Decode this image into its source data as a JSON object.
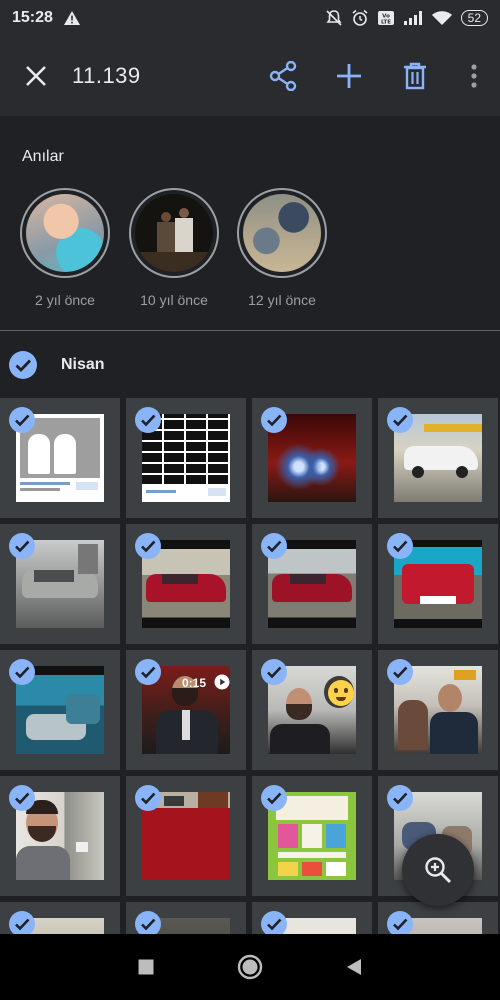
{
  "status": {
    "time": "15:28",
    "battery": "52",
    "icons": [
      "warning-icon",
      "mute-icon",
      "alarm-icon",
      "volte-icon",
      "signal-icon",
      "wifi-icon",
      "battery-icon"
    ]
  },
  "toolbar": {
    "count": "11.139",
    "icons": [
      "close-icon",
      "share-icon",
      "add-icon",
      "delete-icon",
      "more-vert-icon"
    ]
  },
  "memories": {
    "title": "Anılar",
    "items": [
      {
        "label": "2 yıl önce"
      },
      {
        "label": "10 yıl önce"
      },
      {
        "label": "12 yıl önce"
      }
    ]
  },
  "section": {
    "title": "Nisan",
    "selected": true
  },
  "grid": {
    "selected_all": true,
    "rows": [
      [
        {
          "type": "screenshot-cats"
        },
        {
          "type": "screenshot-bricks"
        },
        {
          "type": "photo-night-car"
        },
        {
          "type": "photo-white-car"
        }
      ],
      [
        {
          "type": "photo-silver-car"
        },
        {
          "type": "photo-red-car"
        },
        {
          "type": "photo-red-car"
        },
        {
          "type": "photo-red-car"
        }
      ],
      [
        {
          "type": "photo-interior"
        },
        {
          "type": "video-man",
          "duration": "0:15"
        },
        {
          "type": "photo-man-emoji"
        },
        {
          "type": "photo-barber"
        }
      ],
      [
        {
          "type": "photo-man-portrait"
        },
        {
          "type": "photo-red-carpet"
        },
        {
          "type": "screenshot-catalog"
        },
        {
          "type": "photo-room"
        }
      ],
      [
        {
          "type": "photo"
        },
        {
          "type": "photo"
        },
        {
          "type": "photo"
        },
        {
          "type": "photo"
        }
      ]
    ]
  },
  "fab": {
    "icon": "zoom-in-icon"
  },
  "navbar": {
    "icons": [
      "recents-icon",
      "home-icon",
      "back-icon"
    ]
  },
  "colors": {
    "accent": "#8ab4f8",
    "background": "#202124",
    "toolbar": "#2a2b2e",
    "cell": "#3c4043"
  }
}
